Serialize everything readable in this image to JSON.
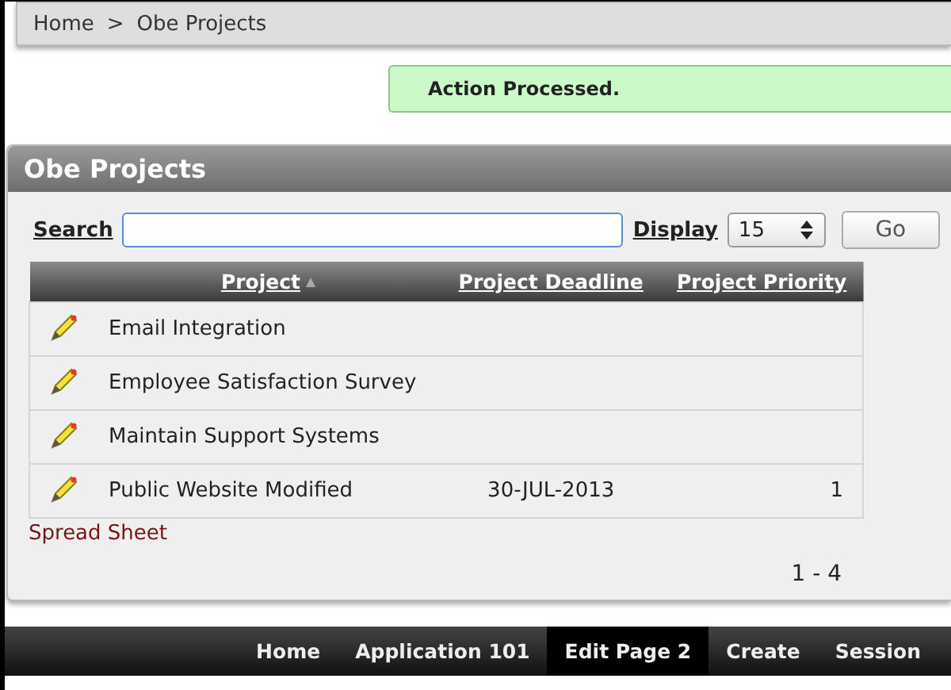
{
  "breadcrumb": [
    "Home",
    ">",
    "Obe Projects"
  ],
  "message": "Action Processed.",
  "region": {
    "title": "Obe Projects",
    "search": {
      "label": "Search"
    },
    "display": {
      "label": "Display",
      "value": "15"
    },
    "go_button": "Go",
    "table": {
      "columns": [
        {
          "label": "Project",
          "sorted": true
        },
        {
          "label": "Project Deadline",
          "sorted": false
        },
        {
          "label": "Project Priority",
          "sorted": false
        }
      ],
      "rows": [
        {
          "project": "Email Integration"
        },
        {
          "project": "Employee Satisfaction Survey"
        },
        {
          "project": "Maintain Support Systems"
        },
        {
          "project": "Public Website Modified",
          "deadline": "30-JUL-2013",
          "priority": "1"
        }
      ]
    },
    "spreadsheet_link": "Spread Sheet",
    "pagination": "1 - 4"
  },
  "developer_toolbar": [
    {
      "label": "Home",
      "selected": false
    },
    {
      "label": "Application 101",
      "selected": false
    },
    {
      "label": "Edit Page 2",
      "selected": true
    },
    {
      "label": "Create",
      "selected": false
    },
    {
      "label": "Session",
      "selected": false
    }
  ]
}
